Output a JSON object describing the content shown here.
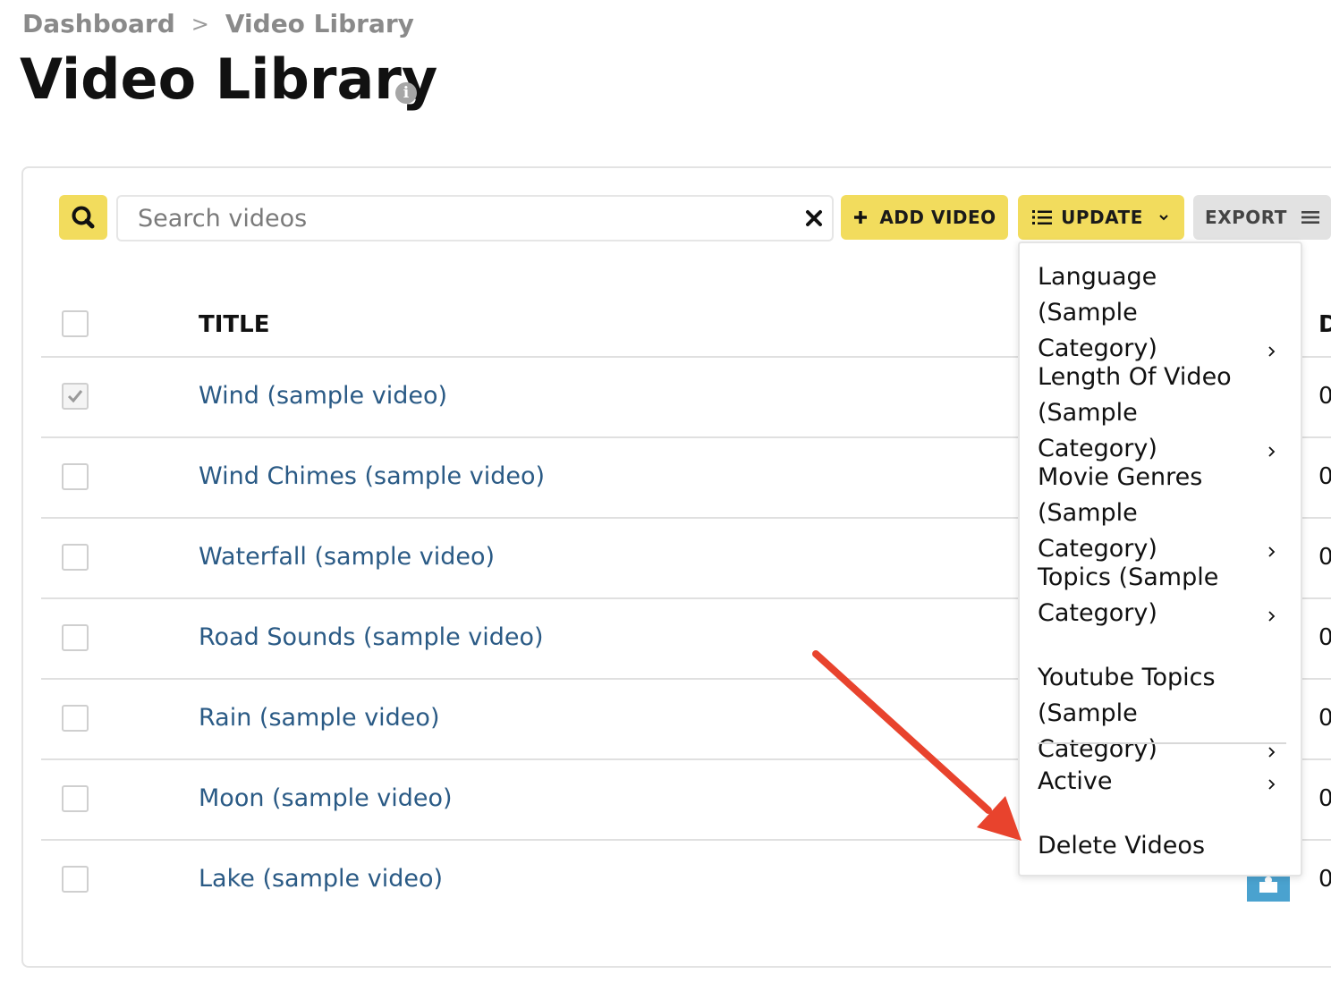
{
  "breadcrumb": {
    "items": [
      "Dashboard",
      "Video Library"
    ],
    "separator": ">"
  },
  "page": {
    "title": "Video Library",
    "info_icon": "info-icon"
  },
  "toolbar": {
    "search_placeholder": "Search videos",
    "search_value": "",
    "add_label": "ADD VIDEO",
    "update_label": "UPDATE",
    "export_label": "EXPORT",
    "accent_color": "#f2dc5d"
  },
  "table": {
    "columns": [
      "TITLE",
      "D"
    ],
    "rows": [
      {
        "title": "Wind (sample video)",
        "checked": true,
        "value": "0"
      },
      {
        "title": "Wind Chimes (sample video)",
        "checked": false,
        "value": "0"
      },
      {
        "title": "Waterfall (sample video)",
        "checked": false,
        "value": "0"
      },
      {
        "title": "Road Sounds (sample video)",
        "checked": false,
        "value": "0"
      },
      {
        "title": "Rain (sample video)",
        "checked": false,
        "value": "0"
      },
      {
        "title": "Moon (sample video)",
        "checked": false,
        "value": "0"
      },
      {
        "title": "Lake (sample video)",
        "checked": false,
        "value": "0"
      }
    ],
    "link_color": "#2a5a85"
  },
  "update_menu": {
    "items": [
      {
        "label": "Language (Sample Category)",
        "submenu": true
      },
      {
        "label": "Length Of Video (Sample Category)",
        "submenu": true
      },
      {
        "label": "Movie Genres (Sample Category)",
        "submenu": true
      },
      {
        "label": "Topics (Sample Category)",
        "submenu": true
      },
      {
        "label": "Youtube Topics (Sample Category)",
        "submenu": true
      },
      {
        "label": "Active",
        "submenu": true
      },
      {
        "label": "Delete Videos",
        "submenu": false
      }
    ]
  },
  "annotation": {
    "arrow_color": "#e8432d",
    "points_to": "Delete Videos"
  }
}
